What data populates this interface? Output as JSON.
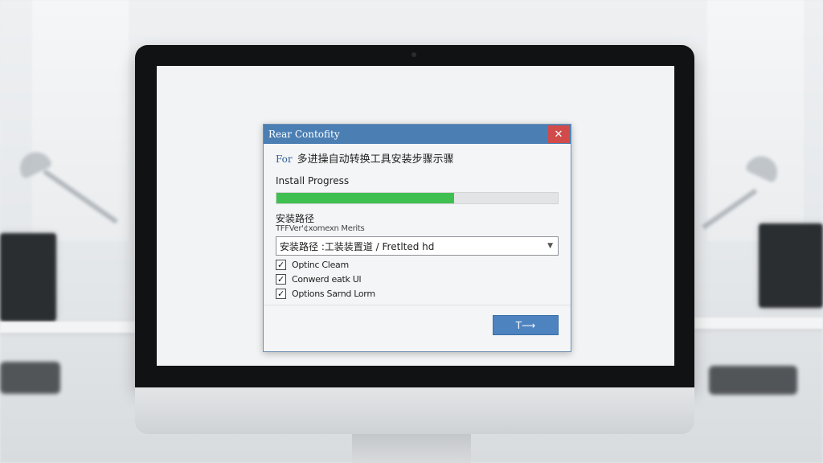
{
  "dialog": {
    "title": "Rear Contofity",
    "close_glyph": "✕",
    "heading_prefix": "For",
    "heading_text": "多进操自动转换工具安装步骤示骤",
    "progress_label": "Install Progress",
    "progress_fraction": 0.63,
    "path_label": "安装路径",
    "path_sublabel": "TFFVer'¢xomexn Merits",
    "path_value": "安装路径 :工装装置道 / Fretlted hd",
    "options": [
      {
        "label": "Optinc Cleam",
        "checked": true
      },
      {
        "label": "Conwerd eatk Ul",
        "checked": true
      },
      {
        "label": "Options Sarnd Lorm",
        "checked": true
      }
    ],
    "check_glyph": "✓",
    "next_button_label": "T⟶",
    "dropdown_icon": "▼"
  },
  "colors": {
    "titlebar": "#4b7fb4",
    "close": "#d24b4b",
    "progress": "#3fbf50",
    "button": "#4d84c0"
  }
}
